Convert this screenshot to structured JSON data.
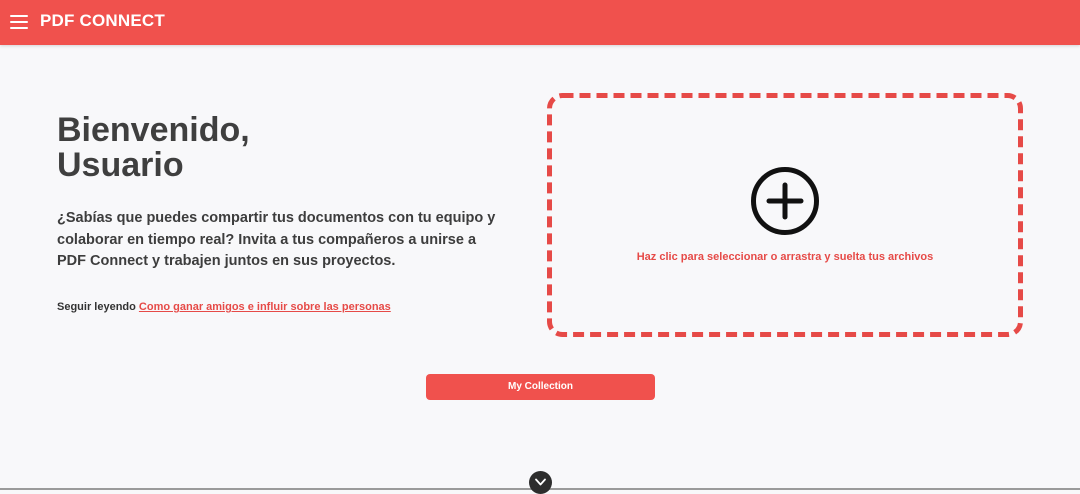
{
  "header": {
    "app_title": "PDF CONNECT",
    "menu_icon": "hamburger-menu-icon",
    "background_color": "#f0514d"
  },
  "main": {
    "welcome_line1": "Bienvenido,",
    "welcome_line2": "Usuario",
    "intro_text": "¿Sabías que puedes compartir tus documentos con tu equipo y colaborar en tiempo real? Invita a tus compañeros a unirse a PDF Connect y trabajen juntos en sus proyectos.",
    "read_more_label": "Seguir leyendo",
    "read_more_link": "Como ganar amigos e influir sobre las personas",
    "collection_button": "My Collection"
  },
  "dropzone": {
    "icon": "plus-circle-icon",
    "instruction": "Haz clic para seleccionar o arrastra y suelta tus archivos",
    "border_color": "#e64a47"
  },
  "footer": {
    "scroll_icon": "chevron-down-icon"
  }
}
